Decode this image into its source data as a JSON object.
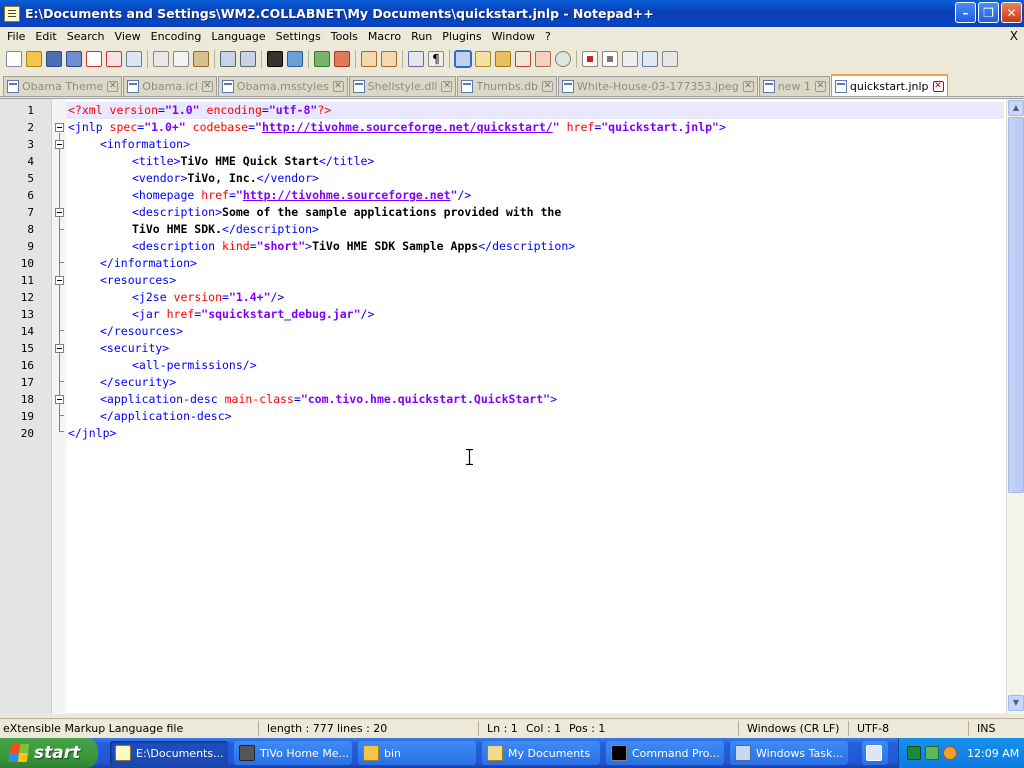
{
  "window": {
    "title": "E:\\Documents and Settings\\WM2.COLLABNET\\My Documents\\quickstart.jnlp - Notepad++"
  },
  "menu": [
    "File",
    "Edit",
    "Search",
    "View",
    "Encoding",
    "Language",
    "Settings",
    "Tools",
    "Macro",
    "Run",
    "Plugins",
    "Window",
    "?"
  ],
  "menu_close": "X",
  "tabs": [
    {
      "label": "Obama Theme",
      "active": false
    },
    {
      "label": "Obama.icl",
      "active": false
    },
    {
      "label": "Obama.msstyles",
      "active": false
    },
    {
      "label": "Shellstyle.dll",
      "active": false
    },
    {
      "label": "Thumbs.db",
      "active": false
    },
    {
      "label": "White-House-03-177353.jpeg",
      "active": false
    },
    {
      "label": "new 1",
      "active": false
    },
    {
      "label": "quickstart.jnlp",
      "active": true
    }
  ],
  "line_numbers": [
    "1",
    "2",
    "3",
    "4",
    "5",
    "6",
    "7",
    "8",
    "9",
    "10",
    "11",
    "12",
    "13",
    "14",
    "15",
    "16",
    "17",
    "18",
    "19",
    "20"
  ],
  "code": {
    "l1": {
      "pi1": "<?xml ",
      "a1": "version",
      "e1": "=",
      "v1": "\"1.0\"",
      "s1": " ",
      "a2": "encoding",
      "e2": "=",
      "v2": "\"utf-8\"",
      "pi2": "?>"
    },
    "l2": {
      "t1": "<jnlp ",
      "a1": "spec",
      "e1": "=",
      "v1": "\"1.0+\"",
      "s1": " ",
      "a2": "codebase",
      "e2": "=",
      "q1": "\"",
      "u1": "http://tivohme.sourceforge.net/quickstart/",
      "q2": "\"",
      "s2": " ",
      "a3": "href",
      "e3": "=",
      "v3": "\"quickstart.jnlp\"",
      "t2": ">"
    },
    "l3": {
      "t1": "<information>"
    },
    "l4": {
      "t1": "<title>",
      "x1": "TiVo HME Quick Start",
      "t2": "</title>"
    },
    "l5": {
      "t1": "<vendor>",
      "x1": "TiVo, Inc.",
      "t2": "</vendor>"
    },
    "l6": {
      "t1": "<homepage ",
      "a1": "href",
      "e1": "=",
      "q1": "\"",
      "u1": "http://tivohme.sourceforge.net",
      "q2": "\"",
      "t2": "/>"
    },
    "l7": {
      "t1": "<description>",
      "x1": "Some of the sample applications provided with the"
    },
    "l8": {
      "x1": "TiVo HME SDK.",
      "t1": "</description>"
    },
    "l9": {
      "t1": "<description ",
      "a1": "kind",
      "e1": "=",
      "v1": "\"short\"",
      "t2": ">",
      "x1": "TiVo HME SDK Sample Apps",
      "t3": "</description>"
    },
    "l10": {
      "t1": "</information>"
    },
    "l11": {
      "t1": "<resources>"
    },
    "l12": {
      "t1": "<j2se ",
      "a1": "version",
      "e1": "=",
      "v1": "\"1.4+\"",
      "t2": "/>"
    },
    "l13": {
      "t1": "<jar ",
      "a1": "href",
      "e1": "=",
      "v1": "\"squickstart_debug.jar\"",
      "t2": "/>"
    },
    "l14": {
      "t1": "</resources>"
    },
    "l15": {
      "t1": "<security>"
    },
    "l16": {
      "t1": "<all-permissions/>"
    },
    "l17": {
      "t1": "</security>"
    },
    "l18": {
      "t1": "<application-desc ",
      "a1": "main-class",
      "e1": "=",
      "v1": "\"com.tivo.hme.quickstart.QuickStart\"",
      "t2": ">"
    },
    "l19": {
      "t1": "</application-desc>"
    },
    "l20": {
      "t1": "</jnlp>"
    }
  },
  "status": {
    "filetype": "eXtensible Markup Language file",
    "length": "length : 777",
    "lines": "lines : 20",
    "ln": "Ln : 1",
    "col": "Col : 1",
    "pos": "Pos : 1",
    "eol": "Windows (CR LF)",
    "encoding": "UTF-8",
    "mode": "INS"
  },
  "taskbar": {
    "start": "start",
    "tasks": [
      "E:\\Documents...",
      "TiVo Home Me...",
      "bin",
      "My Documents",
      "Command Pro...",
      "Windows Task..."
    ],
    "clock": "12:09 AM"
  },
  "colors": {
    "tag": "#0000ff",
    "attribute": "#ff0000",
    "value": "#8000ff",
    "active_tab_accent": "#f8a23a",
    "titlebar": "#0a4fc9"
  }
}
